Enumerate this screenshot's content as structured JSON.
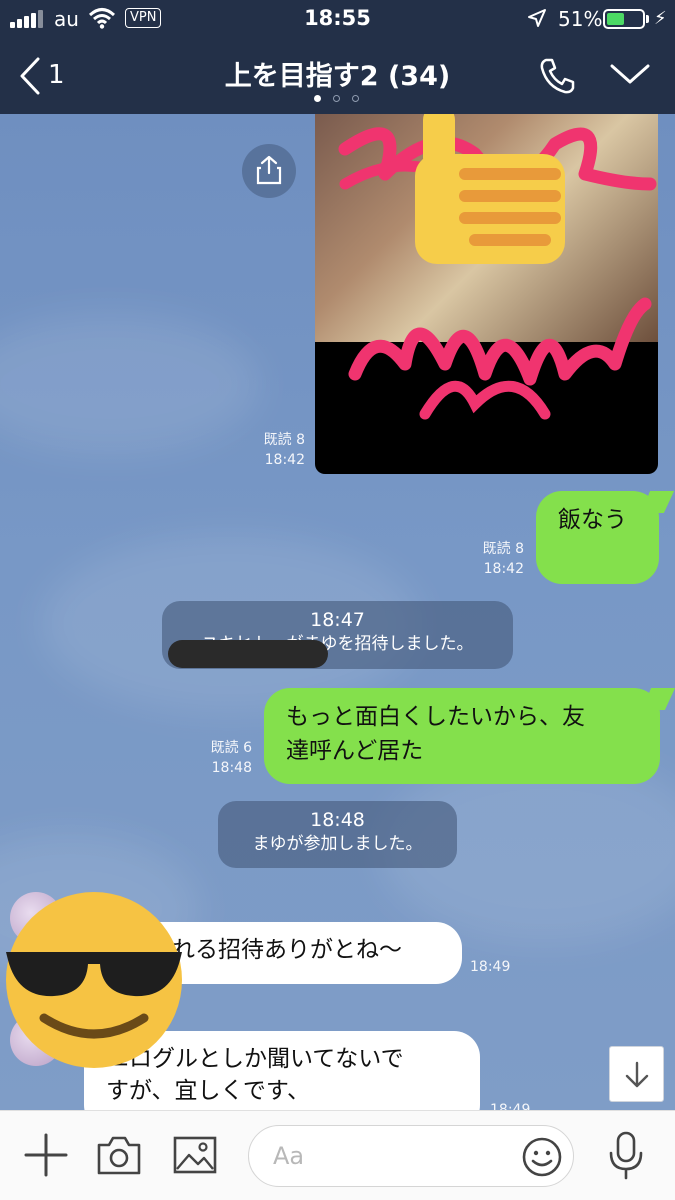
{
  "status_bar": {
    "carrier": "au",
    "vpn": "VPN",
    "time": "18:55",
    "battery_text": "51%",
    "battery_level": 0.51
  },
  "nav": {
    "back_count": "1",
    "title": "上を目指す2 (34)"
  },
  "messages": {
    "photo": {
      "read": "既読 8",
      "time": "18:42"
    },
    "m1": {
      "text": "飯なう",
      "read": "既読 8",
      "time": "18:42"
    },
    "sys1": {
      "time": "18:47",
      "text": "ユキヒトーがまゆを招待しました。"
    },
    "m2": {
      "line1": "もっと面白くしたいから、友",
      "line2": "達呼んど居た",
      "read": "既読 6",
      "time": "18:48"
    },
    "sys2": {
      "time": "18:48",
      "text": "まゆが参加しました。"
    },
    "o1": {
      "text": "れる招待ありがとね～",
      "time": "18:49"
    },
    "o2": {
      "line1": "エログルとしか聞いてないで",
      "line2": "すが、宜しくです、",
      "time": "18:49"
    }
  },
  "input": {
    "placeholder": "Aa"
  },
  "colors": {
    "header": "#233048",
    "my_bubble": "#84e04c",
    "chat_bg": "#7898c6",
    "battery": "#4cd964"
  },
  "icons": [
    "chevron-left-icon",
    "phone-icon",
    "chevron-down-icon",
    "share-icon",
    "thumbs-up-emoji",
    "sunglasses-emoji",
    "arrow-down-icon",
    "plus-icon",
    "camera-icon",
    "image-icon",
    "smiley-icon",
    "microphone-icon"
  ]
}
